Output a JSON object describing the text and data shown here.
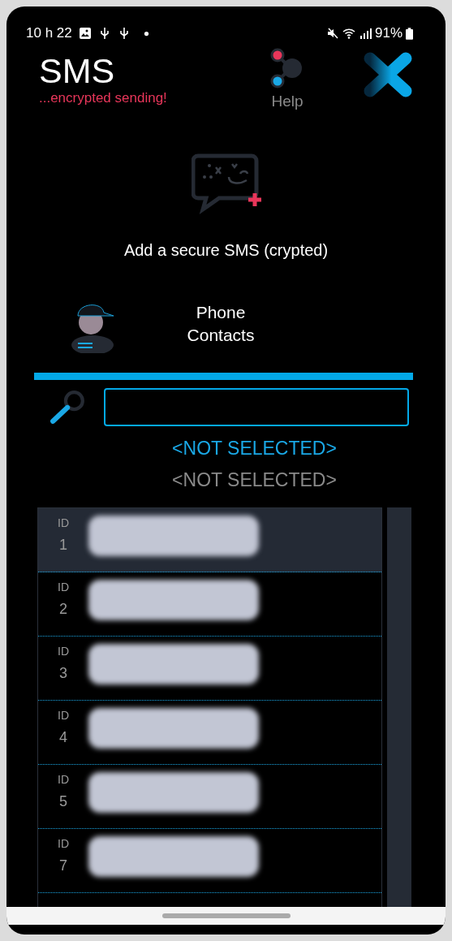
{
  "status_bar": {
    "time": "10 h 22",
    "battery": "91%"
  },
  "header": {
    "title": "SMS",
    "subtitle": "...encrypted sending!",
    "help_label": "Help"
  },
  "add_sms": {
    "label": "Add a secure SMS (crypted)"
  },
  "contacts": {
    "label": "Phone Contacts"
  },
  "selection": [
    {
      "text": "<NOT SELECTED>",
      "kind": "active"
    },
    {
      "text": "<NOT SELECTED>",
      "kind": "inactive"
    }
  ],
  "records": [
    {
      "id_label": "ID",
      "id": "1",
      "selected": true
    },
    {
      "id_label": "ID",
      "id": "2",
      "selected": false
    },
    {
      "id_label": "ID",
      "id": "3",
      "selected": false
    },
    {
      "id_label": "ID",
      "id": "4",
      "selected": false
    },
    {
      "id_label": "ID",
      "id": "5",
      "selected": false
    },
    {
      "id_label": "ID",
      "id": "7",
      "selected": false
    }
  ]
}
